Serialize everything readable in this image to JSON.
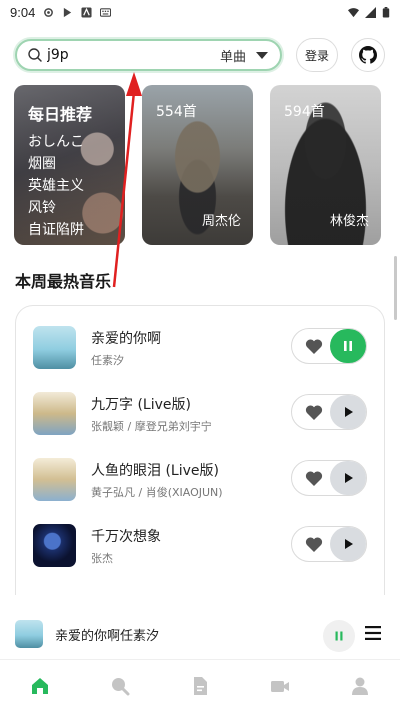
{
  "status_bar": {
    "time": "9:04"
  },
  "search": {
    "query": "j9p",
    "type_label": "单曲"
  },
  "header": {
    "login_label": "登录"
  },
  "cards": {
    "daily": {
      "title": "每日推荐",
      "items": [
        "おしんこ",
        "烟圈",
        "英雄主义",
        "风铃",
        "自证陷阱"
      ]
    },
    "jay": {
      "count": "554首",
      "artist": "周杰伦"
    },
    "jj": {
      "count": "594首",
      "artist": "林俊杰"
    }
  },
  "section": {
    "title": "本周最热音乐"
  },
  "songs": [
    {
      "title": "亲爱的你啊",
      "artist": "任素汐",
      "playing": true
    },
    {
      "title": "九万字 (Live版)",
      "artist": "张靓颖 / 摩登兄弟刘宇宁",
      "playing": false
    },
    {
      "title": "人鱼的眼泪 (Live版)",
      "artist": "黄子弘凡 / 肖俊(XIAOJUN)",
      "playing": false
    },
    {
      "title": "千万次想象",
      "artist": "张杰",
      "playing": false
    }
  ],
  "mini_player": {
    "now_playing": "亲爱的你啊任素汐"
  },
  "nav": {
    "items": [
      "home-icon",
      "search-icon",
      "document-icon",
      "video-icon",
      "user-icon"
    ],
    "active_color": "#27b95d",
    "inactive_color": "#c4c4c4"
  },
  "colors": {
    "accent": "#27b95d",
    "search_border": "#9ed4b1",
    "annotation": "#e02020"
  }
}
